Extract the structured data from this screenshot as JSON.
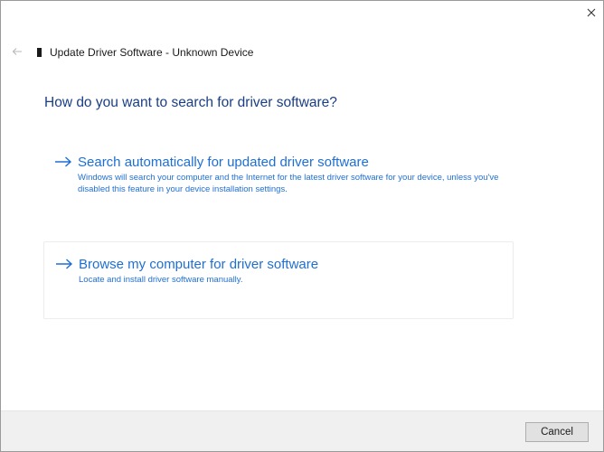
{
  "window": {
    "title": "Update Driver Software - Unknown Device",
    "close_icon": "close-icon",
    "back_icon": "back-arrow-icon"
  },
  "main": {
    "heading": "How do you want to search for driver software?",
    "options": [
      {
        "title": "Search automatically for updated driver software",
        "description": "Windows will search your computer and the Internet for the latest driver software for your device, unless you've disabled this feature in your device installation settings."
      },
      {
        "title": "Browse my computer for driver software",
        "description": "Locate and install driver software manually."
      }
    ]
  },
  "footer": {
    "cancel_label": "Cancel"
  },
  "colors": {
    "heading": "#1a3e86",
    "link": "#1e6fd4",
    "footer_bg": "#f0f0f0"
  }
}
